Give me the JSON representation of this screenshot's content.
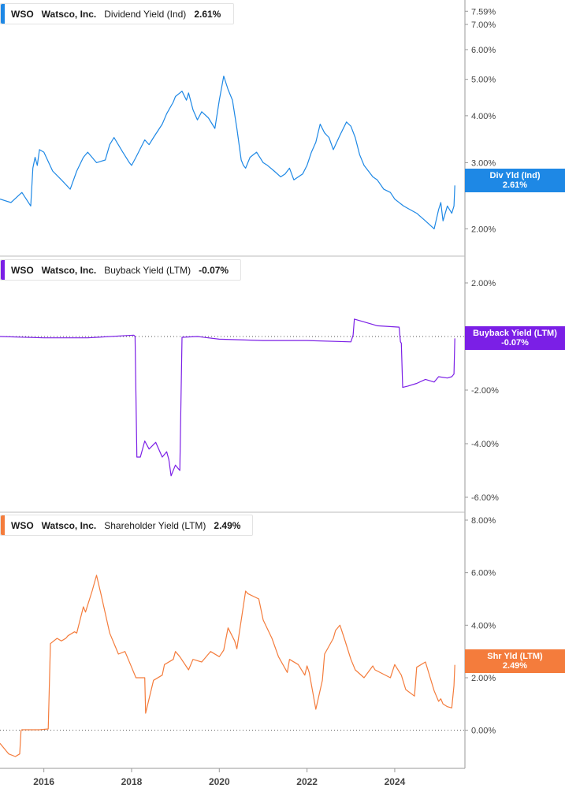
{
  "legends": [
    {
      "ticker": "WSO",
      "company": "Watsco, Inc.",
      "metric": "Dividend Yield (Ind)",
      "value": "2.61%"
    },
    {
      "ticker": "WSO",
      "company": "Watsco, Inc.",
      "metric": "Buyback Yield (LTM)",
      "value": "-0.07%"
    },
    {
      "ticker": "WSO",
      "company": "Watsco, Inc.",
      "metric": "Shareholder Yield (LTM)",
      "value": "2.49%"
    }
  ],
  "tags": [
    {
      "label": "Div Yld (Ind)",
      "value": "2.61%"
    },
    {
      "label": "Buyback Yield (LTM)",
      "value": "-0.07%"
    },
    {
      "label": "Shr Yld (LTM)",
      "value": "2.49%"
    }
  ],
  "colors": {
    "dividend": "#1e88e5",
    "buyback": "#7b1fe6",
    "shareholder": "#f47c3c"
  },
  "chart_data": [
    {
      "type": "line",
      "series": [
        {
          "name": "Dividend Yield (Ind)",
          "color": "#1e88e5",
          "x": [
            2015.0,
            2015.25,
            2015.5,
            2015.7,
            2015.75,
            2015.8,
            2015.85,
            2015.9,
            2016.0,
            2016.2,
            2016.4,
            2016.6,
            2016.75,
            2016.9,
            2017.0,
            2017.2,
            2017.4,
            2017.5,
            2017.6,
            2017.8,
            2017.95,
            2018.0,
            2018.1,
            2018.3,
            2018.4,
            2018.5,
            2018.7,
            2018.8,
            2018.95,
            2019.0,
            2019.15,
            2019.25,
            2019.3,
            2019.4,
            2019.5,
            2019.6,
            2019.75,
            2019.9,
            2020.0,
            2020.1,
            2020.2,
            2020.3,
            2020.4,
            2020.5,
            2020.55,
            2020.6,
            2020.7,
            2020.85,
            2021.0,
            2021.1,
            2021.25,
            2021.4,
            2021.5,
            2021.6,
            2021.7,
            2021.9,
            2022.0,
            2022.1,
            2022.2,
            2022.3,
            2022.4,
            2022.5,
            2022.6,
            2022.75,
            2022.9,
            2023.0,
            2023.1,
            2023.2,
            2023.3,
            2023.4,
            2023.5,
            2023.6,
            2023.75,
            2023.9,
            2024.0,
            2024.2,
            2024.35,
            2024.5,
            2024.7,
            2024.9,
            2025.0,
            2025.05,
            2025.1,
            2025.2,
            2025.3,
            2025.35,
            2025.37
          ],
          "y": [
            2.4,
            2.35,
            2.5,
            2.3,
            2.9,
            3.1,
            2.95,
            3.25,
            3.2,
            2.85,
            2.7,
            2.55,
            2.85,
            3.1,
            3.2,
            3.0,
            3.05,
            3.35,
            3.5,
            3.2,
            3.0,
            2.95,
            3.1,
            3.45,
            3.35,
            3.5,
            3.8,
            4.05,
            4.35,
            4.5,
            4.65,
            4.4,
            4.6,
            4.15,
            3.9,
            4.1,
            3.95,
            3.7,
            4.4,
            5.1,
            4.7,
            4.4,
            3.7,
            3.05,
            2.95,
            2.9,
            3.1,
            3.2,
            3.0,
            2.95,
            2.85,
            2.75,
            2.8,
            2.9,
            2.7,
            2.8,
            2.95,
            3.2,
            3.4,
            3.8,
            3.6,
            3.5,
            3.25,
            3.55,
            3.85,
            3.75,
            3.5,
            3.15,
            2.95,
            2.85,
            2.75,
            2.7,
            2.55,
            2.5,
            2.4,
            2.3,
            2.25,
            2.2,
            2.1,
            2.0,
            2.25,
            2.35,
            2.1,
            2.3,
            2.2,
            2.3,
            2.61
          ]
        }
      ],
      "yticks": [
        "2.00%",
        "3.00%",
        "4.00%",
        "5.00%",
        "6.00%",
        "7.00%",
        "7.59%"
      ],
      "y_scale": "log",
      "ylim": [
        1.75,
        7.6
      ],
      "reference_line": null
    },
    {
      "type": "line",
      "series": [
        {
          "name": "Buyback Yield (LTM)",
          "color": "#7b1fe6",
          "x": [
            2015.0,
            2016.0,
            2017.0,
            2018.05,
            2018.08,
            2018.12,
            2018.2,
            2018.3,
            2018.4,
            2018.55,
            2018.7,
            2018.8,
            2018.85,
            2018.9,
            2019.0,
            2019.1,
            2019.15,
            2019.5,
            2020.0,
            2021.0,
            2022.0,
            2023.0,
            2023.05,
            2023.08,
            2023.5,
            2023.6,
            2024.1,
            2024.13,
            2024.15,
            2024.18,
            2024.3,
            2024.5,
            2024.7,
            2024.9,
            2025.0,
            2025.2,
            2025.3,
            2025.35,
            2025.37
          ],
          "y": [
            0.0,
            -0.05,
            -0.05,
            0.05,
            0.0,
            -4.5,
            -4.5,
            -3.9,
            -4.2,
            -3.95,
            -4.5,
            -4.3,
            -4.6,
            -5.2,
            -4.8,
            -5.0,
            -0.03,
            0.0,
            -0.1,
            -0.15,
            -0.15,
            -0.2,
            0.05,
            0.65,
            0.45,
            0.4,
            0.35,
            -0.2,
            -0.25,
            -1.9,
            -1.85,
            -1.75,
            -1.6,
            -1.7,
            -1.5,
            -1.55,
            -1.5,
            -1.4,
            -0.07
          ]
        }
      ],
      "yticks": [
        "-6.00%",
        "-4.00%",
        "-2.00%",
        "2.00%"
      ],
      "ylim": [
        -6.5,
        2.5
      ],
      "reference_line": 0
    },
    {
      "type": "line",
      "series": [
        {
          "name": "Shareholder Yield (LTM)",
          "color": "#f47c3c",
          "x": [
            2015.0,
            2015.2,
            2015.35,
            2015.45,
            2015.48,
            2015.5,
            2015.6,
            2015.9,
            2016.1,
            2016.15,
            2016.3,
            2016.4,
            2016.5,
            2016.55,
            2016.7,
            2016.75,
            2016.9,
            2016.95,
            2017.1,
            2017.2,
            2017.3,
            2017.5,
            2017.7,
            2017.85,
            2018.0,
            2018.1,
            2018.3,
            2018.32,
            2018.5,
            2018.7,
            2018.75,
            2018.95,
            2019.0,
            2019.1,
            2019.3,
            2019.4,
            2019.6,
            2019.8,
            2020.0,
            2020.1,
            2020.2,
            2020.35,
            2020.4,
            2020.6,
            2020.65,
            2020.9,
            2021.0,
            2021.2,
            2021.35,
            2021.55,
            2021.6,
            2021.8,
            2021.95,
            2022.0,
            2022.05,
            2022.2,
            2022.35,
            2022.4,
            2022.6,
            2022.65,
            2022.75,
            2022.85,
            2023.0,
            2023.1,
            2023.3,
            2023.5,
            2023.55,
            2023.9,
            2024.0,
            2024.15,
            2024.25,
            2024.45,
            2024.5,
            2024.7,
            2024.9,
            2025.0,
            2025.05,
            2025.1,
            2025.2,
            2025.3,
            2025.35,
            2025.37
          ],
          "y": [
            -0.5,
            -0.9,
            -1.0,
            -0.9,
            0.0,
            0.02,
            0.02,
            0.02,
            0.05,
            3.3,
            3.5,
            3.4,
            3.5,
            3.6,
            3.75,
            3.7,
            4.7,
            4.5,
            5.3,
            5.9,
            5.2,
            3.7,
            2.9,
            3.0,
            2.4,
            2.0,
            2.0,
            0.65,
            1.9,
            2.1,
            2.5,
            2.7,
            3.0,
            2.8,
            2.3,
            2.7,
            2.6,
            3.0,
            2.8,
            3.05,
            3.9,
            3.4,
            3.1,
            5.3,
            5.2,
            5.0,
            4.2,
            3.5,
            2.8,
            2.2,
            2.7,
            2.5,
            2.1,
            2.45,
            2.2,
            0.8,
            1.9,
            2.9,
            3.5,
            3.8,
            4.0,
            3.5,
            2.7,
            2.3,
            2.0,
            2.45,
            2.3,
            2.0,
            2.5,
            2.1,
            1.55,
            1.3,
            2.4,
            2.6,
            1.5,
            1.1,
            1.2,
            1.0,
            0.9,
            0.85,
            1.7,
            2.49
          ]
        }
      ],
      "yticks": [
        "0.00%",
        "2.00%",
        "4.00%",
        "6.00%",
        "8.00%"
      ],
      "ylim": [
        -1.0,
        8.0
      ],
      "reference_line": 0
    }
  ],
  "xticks": [
    "2016",
    "2018",
    "2020",
    "2022",
    "2024"
  ],
  "xtick_values": [
    2016,
    2018,
    2020,
    2022,
    2024
  ]
}
